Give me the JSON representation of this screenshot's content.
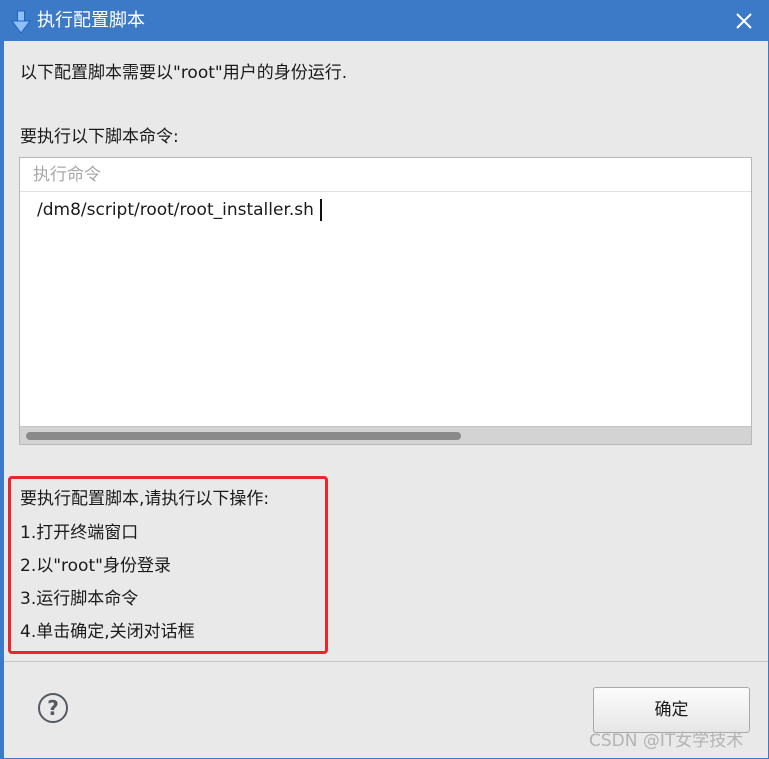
{
  "window": {
    "title": "执行配置脚本",
    "title_icon": "download-arrow-icon",
    "close_icon": "close-icon"
  },
  "message": "以下配置脚本需要以\"root\"用户的身份运行.",
  "command_section": {
    "label": "要执行以下脚本命令:",
    "column_header": "执行命令",
    "rows": [
      "/dm8/script/root/root_installer.sh"
    ]
  },
  "instructions": {
    "heading": "要执行配置脚本,请执行以下操作:",
    "steps": [
      "1.打开终端窗口",
      "2.以\"root\"身份登录",
      "3.运行脚本命令",
      "4.单击确定,关闭对话框"
    ]
  },
  "footer": {
    "help_icon": "help-icon",
    "help_glyph": "?",
    "ok_label": "确定"
  },
  "watermark": "CSDN @IT女学技术",
  "colors": {
    "titlebar": "#3c7ac8",
    "highlight_border": "#e8262b",
    "dialog_bg": "#e9e9e9"
  }
}
